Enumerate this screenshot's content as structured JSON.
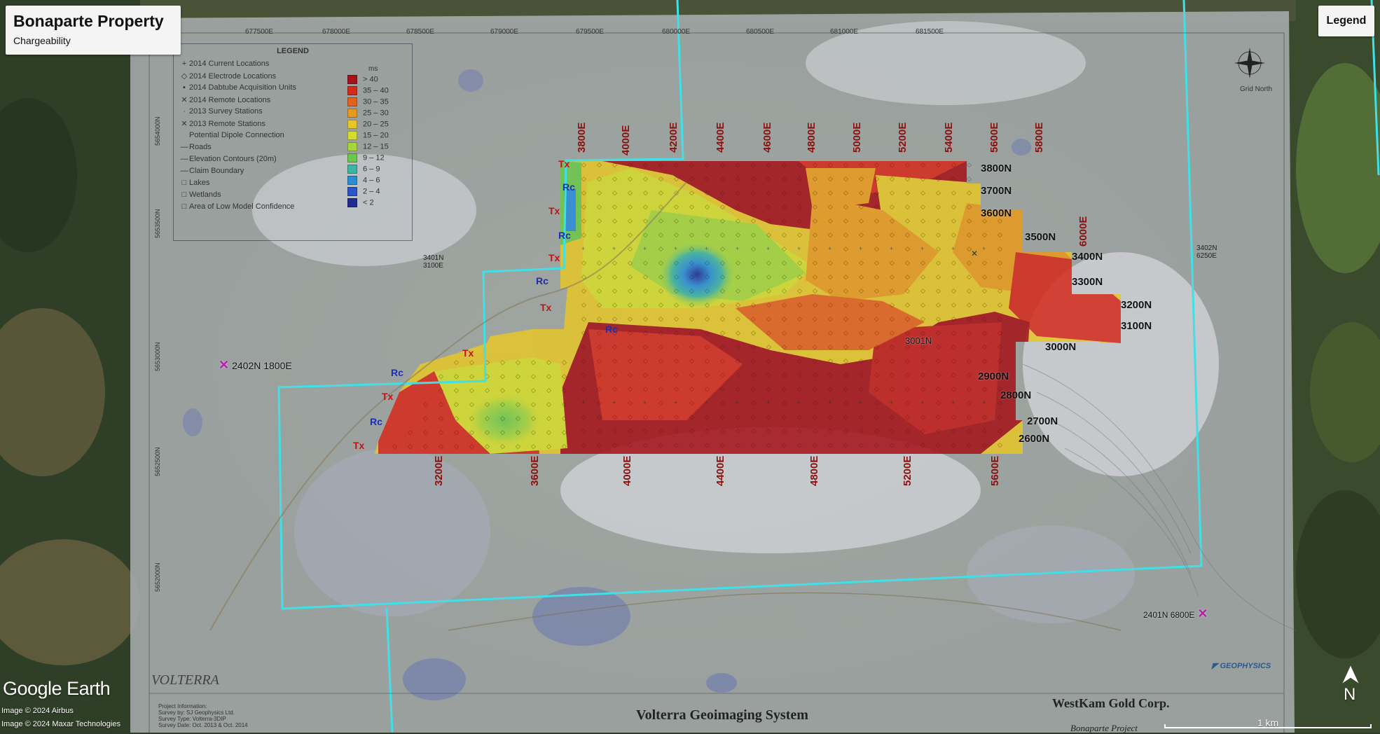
{
  "panel": {
    "title": "Bonaparte Property",
    "subtitle": "Chargeability"
  },
  "legend_button": "Legend",
  "branding": {
    "google_earth": "Google Earth",
    "credits": [
      "Image © 2024 Airbus",
      "Image © 2024 Maxar Technologies"
    ]
  },
  "scale_bar": "1 km",
  "north_arrow": "N",
  "map": {
    "legend_title": "LEGEND",
    "legend_items": [
      {
        "symbol": "+",
        "label": "2014 Current Locations"
      },
      {
        "symbol": "◇",
        "label": "2014 Electrode Locations"
      },
      {
        "symbol": "▪",
        "label": "2014 Dabtube Acquisition Units"
      },
      {
        "symbol": "✕",
        "label": "2014 Remote Locations"
      },
      {
        "symbol": "·",
        "label": "2013 Survey Stations"
      },
      {
        "symbol": "✕",
        "label": "2013 Remote Stations"
      },
      {
        "symbol": "",
        "label": "Potential Dipole Connection"
      },
      {
        "symbol": "—",
        "label": "Roads"
      },
      {
        "symbol": "—",
        "label": "Elevation Contours (20m)"
      },
      {
        "symbol": "—",
        "label": "Claim Boundary"
      },
      {
        "symbol": "□",
        "label": "Lakes"
      },
      {
        "symbol": "□",
        "label": "Wetlands"
      },
      {
        "symbol": "□",
        "label": "Area of Low Model Confidence"
      }
    ],
    "legend_unit": "ms",
    "legend_classes": [
      {
        "label": "> 40",
        "color": "#a51218"
      },
      {
        "label": "35 – 40",
        "color": "#d42a1c"
      },
      {
        "label": "30 – 35",
        "color": "#e4621c"
      },
      {
        "label": "25 – 30",
        "color": "#e89a1e"
      },
      {
        "label": "20 – 25",
        "color": "#e6c62a"
      },
      {
        "label": "15 – 20",
        "color": "#d6dc2c"
      },
      {
        "label": "12 – 15",
        "color": "#a6d63a"
      },
      {
        "label": "9 – 12",
        "color": "#6cc84c"
      },
      {
        "label": "6 – 9",
        "color": "#3cb6a0"
      },
      {
        "label": "4 – 6",
        "color": "#2a8ed6"
      },
      {
        "label": "2 – 4",
        "color": "#2a54c8"
      },
      {
        "label": "< 2",
        "color": "#1e2a92"
      }
    ],
    "easting_ticks": [
      "677500E",
      "678000E",
      "678500E",
      "679000E",
      "679500E",
      "680000E",
      "680500E",
      "681000E",
      "681500E"
    ],
    "northing_ticks": [
      "5654000N",
      "5653500N",
      "5653000N",
      "5652500N",
      "5652000N"
    ],
    "compass_caption": "Grid North",
    "grid_north_lines": [
      "3800N",
      "3700N",
      "3600N",
      "3500N",
      "3400N",
      "3300N",
      "3200N",
      "3100N",
      "3000N",
      "2900N",
      "2800N",
      "2700N",
      "2600N"
    ],
    "grid_east_top": [
      "3800E",
      "4000E",
      "4200E",
      "4400E",
      "4600E",
      "4800E",
      "5000E",
      "5200E",
      "5400E",
      "5600E",
      "5800E",
      "6000E"
    ],
    "grid_east_bottom": [
      "3200E",
      "3600E",
      "4000E",
      "4400E",
      "4800E",
      "5200E",
      "5600E"
    ],
    "tx_labels": [
      "Tx",
      "Tx",
      "Tx",
      "Tx",
      "Tx",
      "Tx",
      "Tx"
    ],
    "rc_labels": [
      "Rc",
      "Rc",
      "Rc",
      "Rc",
      "Rc",
      "Rc"
    ],
    "interior_label": "3001N",
    "remote_stations": [
      {
        "label": "2402N 1800E"
      },
      {
        "label": "2401N 6800E"
      }
    ],
    "small_station_1": [
      "3401N",
      "3100E"
    ],
    "small_station_2": [
      "3402N",
      "6250E"
    ],
    "footer_title": "Volterra Geoimaging System",
    "footer_company": "WestKam Gold Corp.",
    "footer_project": "Bonaparte Project",
    "volterra_logo": "VOLTERRA",
    "geophysics_logo": "GEOPHYSICS",
    "project_info": [
      "Project Information:",
      "Survey by: SJ Geophysics Ltd.",
      "Survey Type: Volterra-3DIP",
      "Survey Date: Oct. 2013 & Oct. 2014"
    ]
  }
}
